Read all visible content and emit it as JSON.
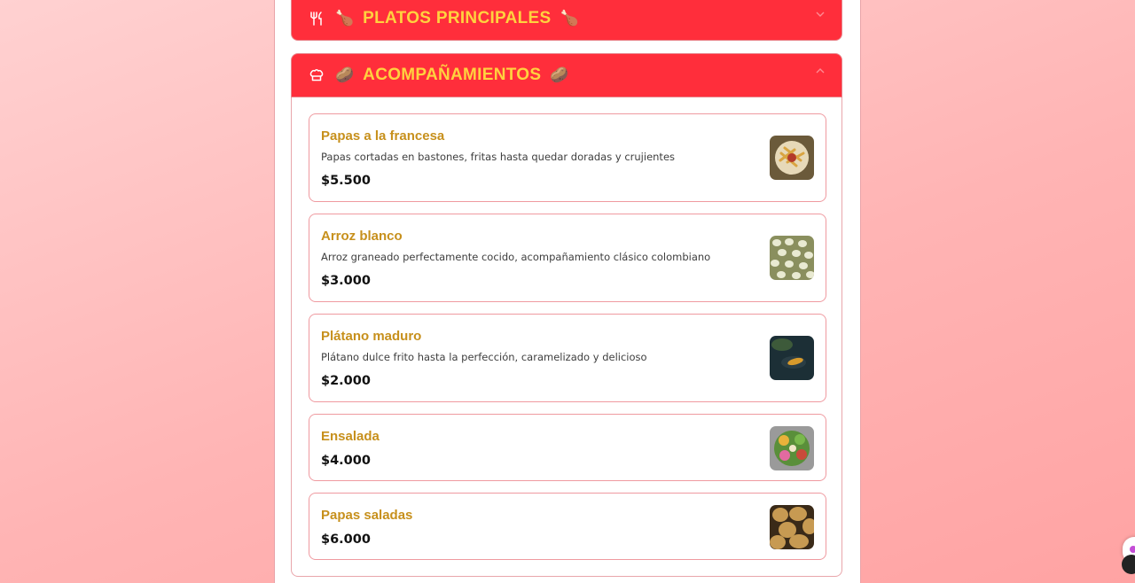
{
  "sections": [
    {
      "id": "platos",
      "title": "PLATOS PRINCIPALES",
      "icon": "fork-knife-icon",
      "emoji": "🍗",
      "collapsed": true
    },
    {
      "id": "acompanamientos",
      "title": "ACOMPAÑAMIENTOS",
      "icon": "chef-hat-icon",
      "emoji": "🥔",
      "collapsed": false,
      "items": [
        {
          "name": "Papas a la francesa",
          "description": "Papas cortadas en bastones, fritas hasta quedar doradas y crujientes",
          "price": "$5.500",
          "image": "french-fries-image"
        },
        {
          "name": "Arroz blanco",
          "description": "Arroz graneado perfectamente cocido, acompañamiento clásico colombiano",
          "price": "$3.000",
          "image": "white-rice-image"
        },
        {
          "name": "Plátano maduro",
          "description": "Plátano dulce frito hasta la perfección, caramelizado y delicioso",
          "price": "$2.000",
          "image": "fried-plantain-image"
        },
        {
          "name": "Ensalada",
          "description": "",
          "price": "$4.000",
          "image": "salad-image"
        },
        {
          "name": "Papas saladas",
          "description": "",
          "price": "$6.000",
          "image": "salted-potatoes-image"
        }
      ]
    }
  ],
  "colors": {
    "header_bg": "#ff2e3b",
    "header_text": "#ffd23f",
    "item_name": "#c7901c",
    "item_border": "#ef9aa0",
    "price": "#111111",
    "background_gradient_start": "#ffd1d1",
    "background_gradient_end": "#ffa3a3"
  }
}
